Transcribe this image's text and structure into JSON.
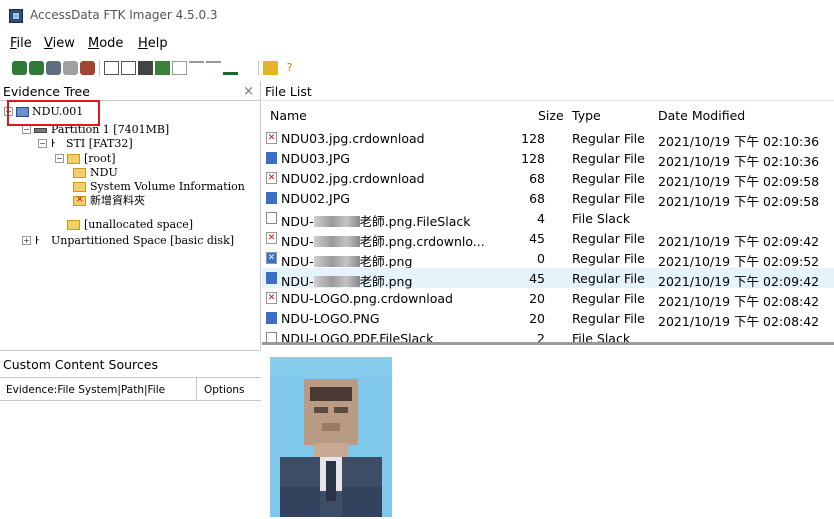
{
  "window": {
    "title": "AccessData FTK Imager 4.5.0.3"
  },
  "menu": [
    "File",
    "View",
    "Mode",
    "Help"
  ],
  "toolbar": {
    "icons": [
      "add-evidence-icon",
      "add-all-evidence-icon",
      "image-mounting-icon",
      "remove-evidence-icon",
      "remove-all-icon",
      "create-image-icon",
      "export-disk-image-icon",
      "export-logical-image-icon",
      "add-to-custom-content-icon",
      "create-custom-image-icon",
      "verify-drive-icon",
      "capture-memory-icon",
      "obtain-protected-files-icon",
      "detect-encryption-icon",
      "help-icon"
    ]
  },
  "evidence_tree": {
    "title": "Evidence Tree",
    "close": "×",
    "nodes": [
      {
        "label": "NDU.001",
        "expander": "−"
      },
      {
        "label": "Partition 1 [7401MB]",
        "expander": "−"
      },
      {
        "label": "STI [FAT32]",
        "expander": "−"
      },
      {
        "label": "[root]",
        "expander": "−"
      },
      {
        "label": "NDU"
      },
      {
        "label": "System Volume Information"
      },
      {
        "label": "新增資料夾"
      },
      {
        "label": "[unallocated space]"
      },
      {
        "label": "Unpartitioned Space [basic disk]",
        "expander": "+"
      }
    ]
  },
  "file_list": {
    "title": "File List",
    "columns": {
      "name": "Name",
      "size": "Size",
      "type": "Type",
      "date": "Date Modified"
    },
    "rows": [
      {
        "icon": "del",
        "name": "NDU03.jpg.crdownload",
        "size": "128",
        "type": "Regular File",
        "date": "2021/10/19 下午 02:10:36"
      },
      {
        "icon": "img",
        "name": "NDU03.JPG",
        "size": "128",
        "type": "Regular File",
        "date": "2021/10/19 下午 02:10:36"
      },
      {
        "icon": "del",
        "name": "NDU02.jpg.crdownload",
        "size": "68",
        "type": "Regular File",
        "date": "2021/10/19 下午 02:09:58"
      },
      {
        "icon": "img",
        "name": "NDU02.JPG",
        "size": "68",
        "type": "Regular File",
        "date": "2021/10/19 下午 02:09:58"
      },
      {
        "icon": "blank",
        "name_prefix": "NDU-",
        "name_suffix": "老師.png.FileSlack",
        "size": "4",
        "type": "File Slack",
        "date": ""
      },
      {
        "icon": "del",
        "name_prefix": "NDU-",
        "name_suffix": "老師.png.crdownlo...",
        "size": "45",
        "type": "Regular File",
        "date": "2021/10/19 下午 02:09:42"
      },
      {
        "icon": "del",
        "name_prefix": "NDU-",
        "name_suffix": "老師.png",
        "size": "0",
        "type": "Regular File",
        "date": "2021/10/19 下午 02:09:52"
      },
      {
        "icon": "img",
        "name_prefix": "NDU-",
        "name_suffix": "老師.png",
        "size": "45",
        "type": "Regular File",
        "date": "2021/10/19 下午 02:09:42",
        "selected": true
      },
      {
        "icon": "del",
        "name": "NDU-LOGO.png.crdownload",
        "size": "20",
        "type": "Regular File",
        "date": "2021/10/19 下午 02:08:42"
      },
      {
        "icon": "img",
        "name": "NDU-LOGO.PNG",
        "size": "20",
        "type": "Regular File",
        "date": "2021/10/19 下午 02:08:42"
      },
      {
        "icon": "blank",
        "name": "NDU-LOGO.PDF.FileSlack",
        "size": "2",
        "type": "File Slack",
        "date": ""
      }
    ]
  },
  "custom_content": {
    "title": "Custom Content Sources",
    "col_path": "Evidence:File System|Path|File",
    "col_options": "Options"
  },
  "colors": {
    "highlight": "#e01818",
    "selected_row": "#e5f3fb",
    "photo_bg": "#7fc8ec"
  }
}
